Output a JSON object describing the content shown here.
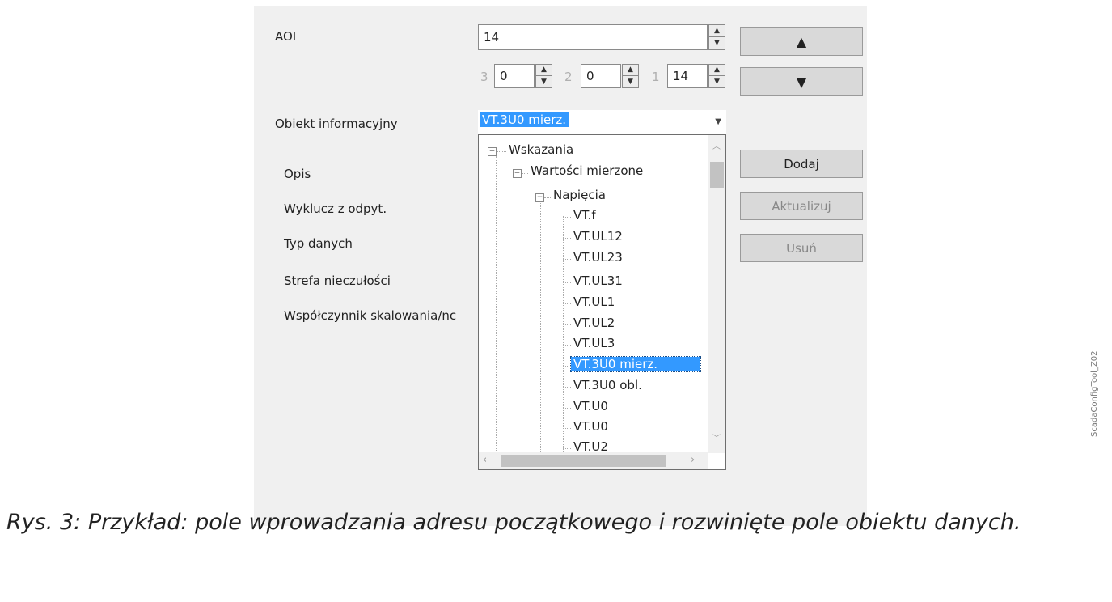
{
  "form": {
    "aoi_label": "AOI",
    "aoi_value": "14",
    "sub_index_3_label": "3",
    "sub_index_3_value": "0",
    "sub_index_2_label": "2",
    "sub_index_2_value": "0",
    "sub_index_1_label": "1",
    "sub_index_1_value": "14",
    "info_object_label": "Obiekt informacyjny",
    "info_object_value": "VT.3U0 mierz.",
    "description_label": "Opis",
    "exclude_label": "Wyklucz z odpyt.",
    "data_type_label": "Typ danych",
    "deadband_label": "Strefa nieczułości",
    "scaling_label": "Współczynnik skalowania/nc"
  },
  "buttons": {
    "up": "▲",
    "down": "▼",
    "add": "Dodaj",
    "update": "Aktualizuj",
    "remove": "Usuń"
  },
  "tree": {
    "root": "Wskazania",
    "level1": "Wartości mierzone",
    "level2": "Napięcia",
    "items": [
      "VT.f",
      "VT.UL12",
      "VT.UL23",
      "VT.UL31",
      "VT.UL1",
      "VT.UL2",
      "VT.UL3",
      "VT.3U0 mierz.",
      "VT.3U0 obl.",
      "VT.U0",
      "VT.U0",
      "VT.U2"
    ],
    "selected_index": 7
  },
  "caption": "Rys. 3:      Przykład: pole wprowadzania adresu początkowego i rozwinięte pole obiektu danych.",
  "side_note": "ScadaConfigTool_Z02"
}
